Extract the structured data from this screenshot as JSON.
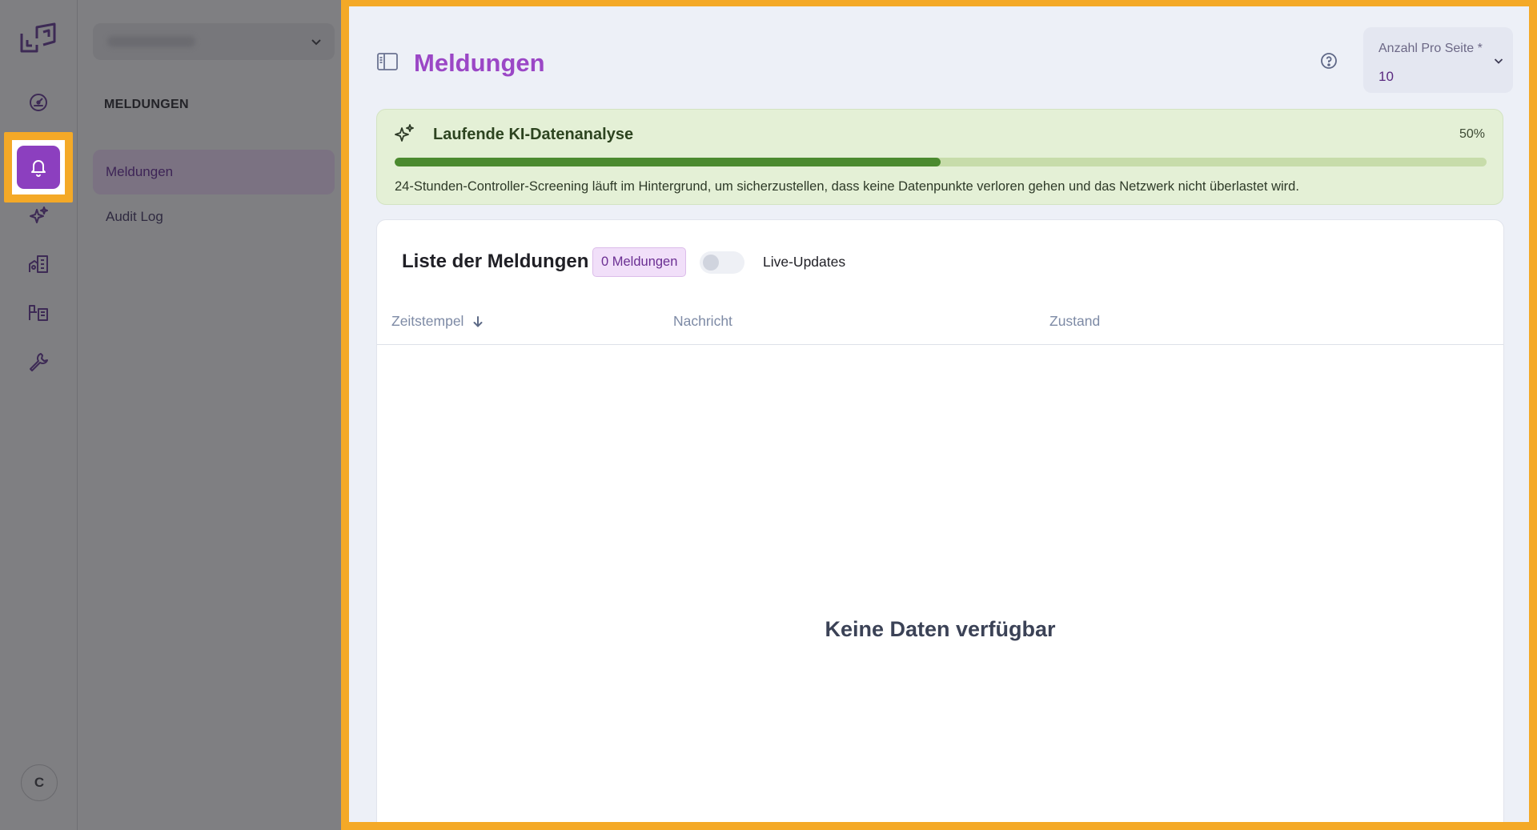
{
  "rail": {
    "nav_icons": [
      "logo-icon",
      "dashboard-icon",
      "bell-icon",
      "sparkles-icon",
      "building-icon",
      "inventory-icon",
      "wrench-icon"
    ],
    "avatar_initial": "C"
  },
  "sidebar": {
    "heading": "MELDUNGEN",
    "items": [
      {
        "label": "Meldungen",
        "active": true
      },
      {
        "label": "Audit Log",
        "active": false
      }
    ]
  },
  "header": {
    "title": "Meldungen",
    "per_page": {
      "label": "Anzahl Pro Seite *",
      "value": "10"
    }
  },
  "ai_analysis": {
    "title": "Laufende KI-Datenanalyse",
    "progress_label": "50%",
    "progress": 0.5,
    "description": "24-Stunden-Controller-Screening läuft im Hintergrund, um sicherzustellen, dass keine Datenpunkte verloren gehen und das Netzwerk nicht überlastet wird."
  },
  "list": {
    "title": "Liste der Meldungen",
    "count_badge": "0 Meldungen",
    "live_updates_label": "Live-Updates",
    "live_updates_on": false,
    "columns": [
      "Zeitstempel",
      "Nachricht",
      "Zustand"
    ],
    "sort_column": "Zeitstempel",
    "rows": [],
    "empty_text": "Keine Daten verfügbar"
  },
  "colors": {
    "accent": "#9b47c6",
    "highlight": "#f4a927",
    "progress": "#4b8a2f"
  }
}
